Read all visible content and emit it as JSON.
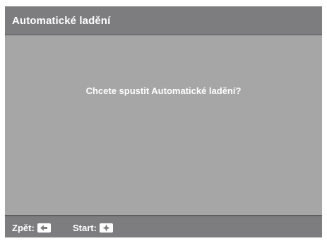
{
  "window": {
    "title": "Automatické ladění"
  },
  "dialog": {
    "prompt": "Chcete spustit Automatické ladění?"
  },
  "footer": {
    "back_label": "Zpět:",
    "back_key_icon": "arrow-left-icon",
    "start_label": "Start:",
    "start_key_icon": "dpad-center-icon"
  },
  "colors": {
    "title_bar": "#7d7d7f",
    "body": "#a6a6a7",
    "footer": "#7d7d7f",
    "text": "#ffffff"
  }
}
